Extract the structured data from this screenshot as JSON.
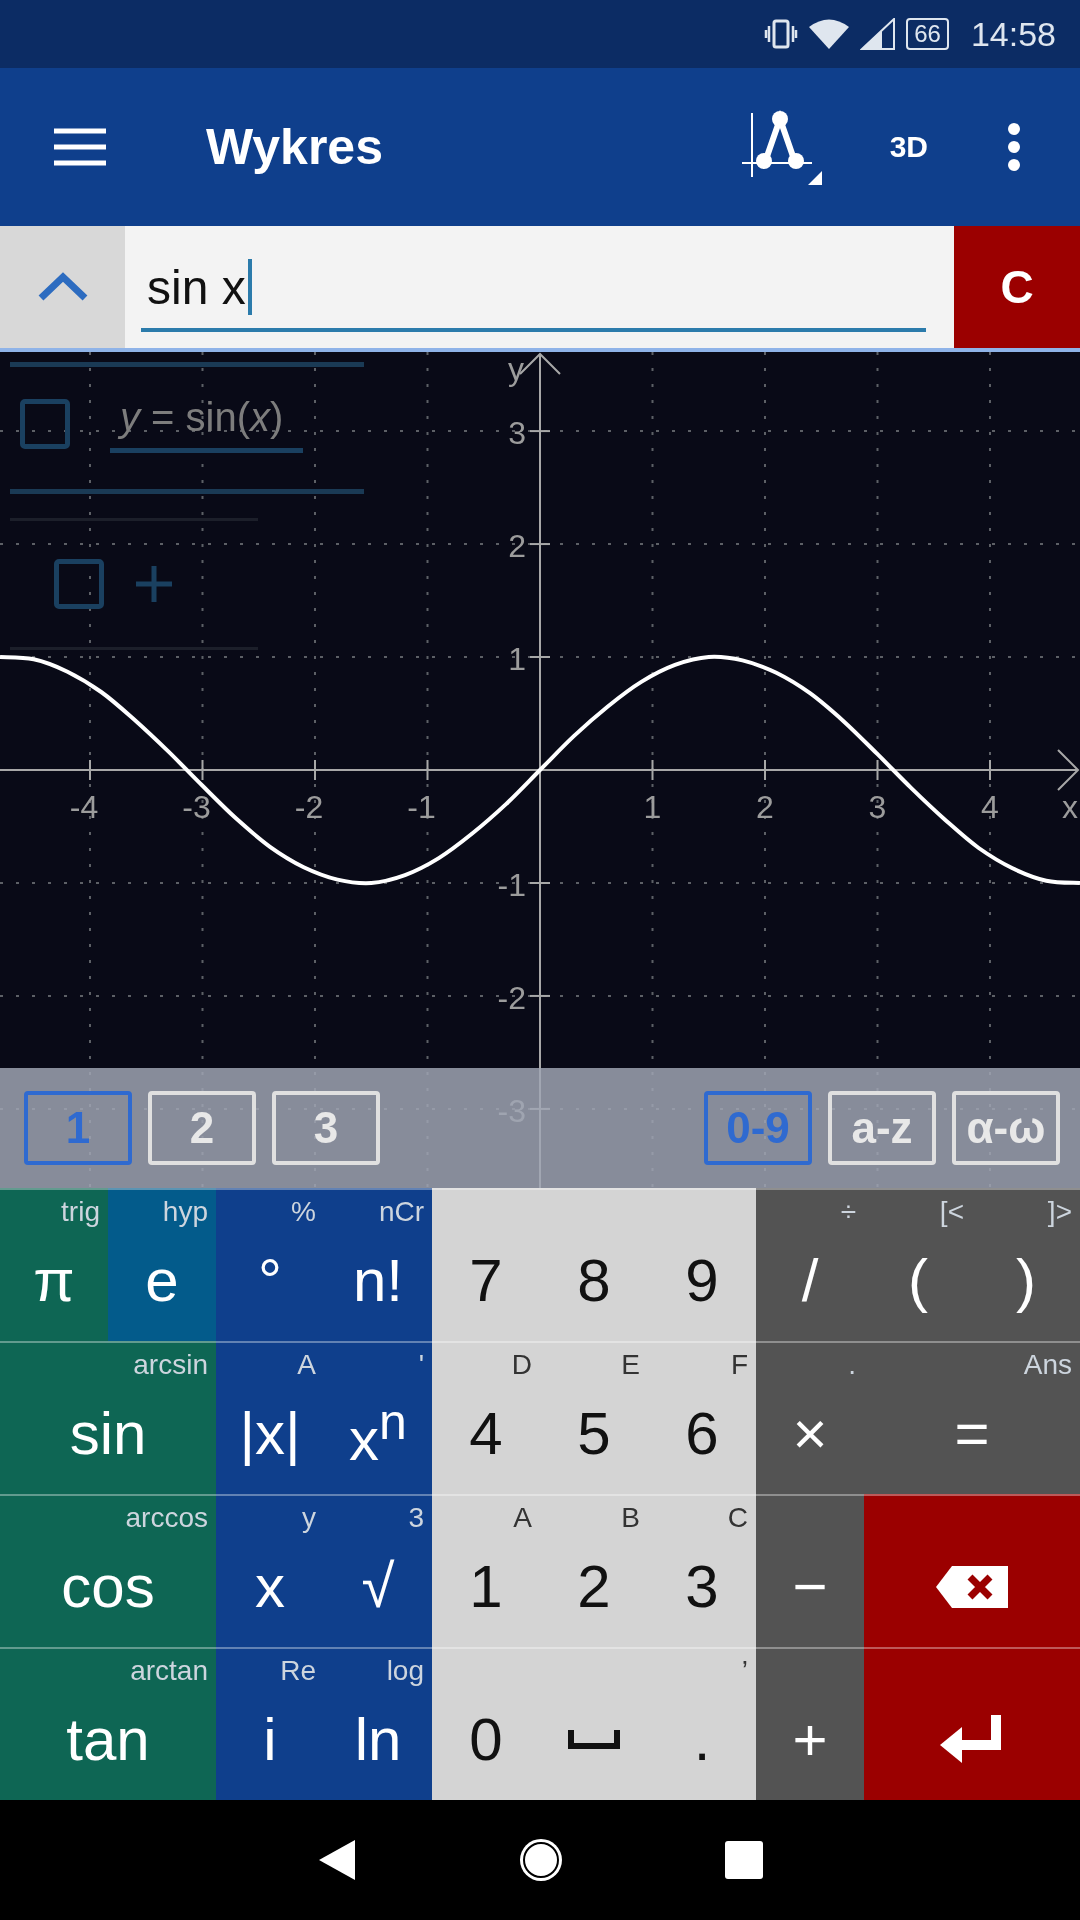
{
  "status_bar": {
    "battery": "66",
    "time": "14:58"
  },
  "app_bar": {
    "title": "Wykres",
    "mode_button": "3D"
  },
  "input": {
    "value": "sin x",
    "clear_button": "C"
  },
  "algebra_panel": [
    {
      "kind": "formula",
      "text": "*y* = sin(*x*)",
      "checked": false
    },
    {
      "kind": "add",
      "checked": false
    }
  ],
  "graph": {
    "chart_data": {
      "type": "line",
      "grid": true,
      "xlabel": "x",
      "ylabel": "y",
      "xlim": [
        -4.8,
        4.8
      ],
      "ylim": [
        -3.7,
        3.7
      ],
      "xticks": [
        -4,
        -3,
        -2,
        -1,
        1,
        2,
        3,
        4
      ],
      "yticks": [
        -3,
        -2,
        -1,
        1,
        2,
        3
      ],
      "x": [
        -4.8,
        -4.5,
        -4.2,
        -3.9,
        -3.6,
        -3.3,
        -3.0,
        -2.7,
        -2.4,
        -2.1,
        -1.8,
        -1.5,
        -1.2,
        -0.9,
        -0.6,
        -0.3,
        0,
        0.3,
        0.6,
        0.9,
        1.2,
        1.5,
        1.8,
        2.1,
        2.4,
        2.7,
        3.0,
        3.3,
        3.6,
        3.9,
        4.2,
        4.5,
        4.8
      ],
      "series": [
        {
          "color": "#ffffff",
          "values": [
            1.0,
            0.98,
            0.87,
            0.69,
            0.44,
            0.16,
            -0.14,
            -0.43,
            -0.68,
            -0.86,
            -0.97,
            -1.0,
            -0.93,
            -0.78,
            -0.56,
            -0.3,
            0,
            0.3,
            0.56,
            0.78,
            0.93,
            1.0,
            0.97,
            0.86,
            0.68,
            0.43,
            0.14,
            -0.16,
            -0.44,
            -0.69,
            -0.87,
            -0.98,
            -1.0
          ]
        }
      ]
    }
  },
  "keyboard_tabs": {
    "left": [
      {
        "label": "1",
        "selected": true
      },
      {
        "label": "2",
        "selected": false
      },
      {
        "label": "3",
        "selected": false
      }
    ],
    "right": [
      {
        "label": "0-9",
        "selected": true
      },
      {
        "label": "a-z",
        "selected": false
      },
      {
        "label": "α-ω",
        "selected": false
      }
    ]
  },
  "keyboard": [
    [
      {
        "kind": "text",
        "label": "π",
        "sub": "trig",
        "color": "#0e6654",
        "wide": false
      },
      {
        "kind": "text",
        "label": "e",
        "sub": "hyp",
        "color": "#035b8b",
        "wide": false
      },
      {
        "kind": "text",
        "label": "°",
        "sub": "%",
        "color": "#0f3f8c",
        "wide": false
      },
      {
        "kind": "text",
        "label": "n!",
        "sub": "nCr",
        "color": "#0f3f8c",
        "wide": false
      },
      {
        "kind": "text",
        "label": "7",
        "color": "#d4d4d4",
        "wide": false
      },
      {
        "kind": "text",
        "label": "8",
        "color": "#d4d4d4",
        "wide": false
      },
      {
        "kind": "text",
        "label": "9",
        "color": "#d4d4d4",
        "wide": false
      },
      {
        "kind": "text",
        "label": "/",
        "sub": "÷",
        "color": "#535353",
        "wide": false
      },
      {
        "kind": "text",
        "label": "(",
        "sub": "[<",
        "color": "#535353",
        "wide": false
      },
      {
        "kind": "text",
        "label": ")",
        "sub": "]>",
        "color": "#535353",
        "wide": false
      }
    ],
    [
      {
        "kind": "text",
        "label": "sin",
        "sub": "arcsin",
        "color": "#0e6654",
        "wide": true
      },
      {
        "kind": "text",
        "label": "|x|",
        "sub": "A",
        "color": "#0f3f8c",
        "wide": false
      },
      {
        "kind": "text",
        "label": "x$^{n}$",
        "sub": "'",
        "color": "#0f3f8c",
        "wide": false
      },
      {
        "kind": "text",
        "label": "4",
        "sub": "D",
        "color": "#d4d4d4",
        "wide": false
      },
      {
        "kind": "text",
        "label": "5",
        "sub": "E",
        "color": "#d4d4d4",
        "wide": false
      },
      {
        "kind": "text",
        "label": "6",
        "sub": "F",
        "color": "#d4d4d4",
        "wide": false
      },
      {
        "kind": "text",
        "label": "×",
        "sub": ".",
        "color": "#535353",
        "wide": false
      },
      {
        "kind": "text",
        "label": "=",
        "sub": "Ans",
        "color": "#535353",
        "wide": true
      }
    ],
    [
      {
        "kind": "text",
        "label": "cos",
        "sub": "arccos",
        "color": "#0e6654",
        "wide": true
      },
      {
        "kind": "text",
        "label": "x",
        "sub": "y",
        "color": "#0f3f8c",
        "wide": false
      },
      {
        "kind": "text",
        "label": "√",
        "sub": "3",
        "color": "#0f3f8c",
        "wide": false
      },
      {
        "kind": "text",
        "label": "1",
        "sub": "A",
        "color": "#d4d4d4",
        "wide": false
      },
      {
        "kind": "text",
        "label": "2",
        "sub": "B",
        "color": "#d4d4d4",
        "wide": false
      },
      {
        "kind": "text",
        "label": "3",
        "sub": "C",
        "color": "#d4d4d4",
        "wide": false
      },
      {
        "kind": "text",
        "label": "−",
        "color": "#535353",
        "wide": false
      },
      {
        "kind": "backspace",
        "color": "#9b0000",
        "wide": true
      }
    ],
    [
      {
        "kind": "text",
        "label": "tan",
        "sub": "arctan",
        "color": "#0e6654",
        "wide": true
      },
      {
        "kind": "text",
        "label": "i",
        "sub": "Re",
        "color": "#0f3f8c",
        "wide": false
      },
      {
        "kind": "text",
        "label": "ln",
        "sub": "log",
        "color": "#0f3f8c",
        "wide": false
      },
      {
        "kind": "text",
        "label": "0",
        "color": "#d4d4d4",
        "wide": false
      },
      {
        "kind": "space",
        "color": "#d4d4d4",
        "wide": false
      },
      {
        "kind": "text",
        "label": ".",
        "sub": "’",
        "color": "#d4d4d4",
        "wide": false
      },
      {
        "kind": "text",
        "label": "+",
        "color": "#535353",
        "wide": false
      },
      {
        "kind": "enter",
        "color": "#9b0000",
        "wide": true
      }
    ]
  ]
}
